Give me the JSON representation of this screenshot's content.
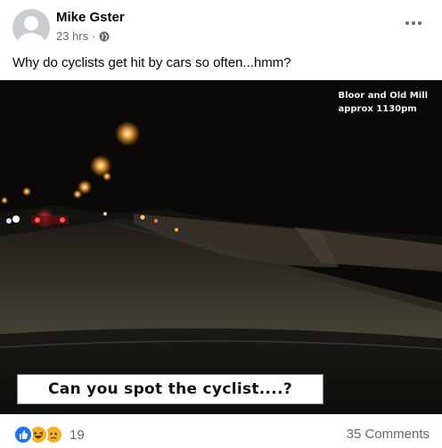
{
  "post": {
    "author": "Mike Gster",
    "time": "23 hrs",
    "dot": "·",
    "privacy_icon": "globe-icon",
    "more_icon": "more-dots-icon",
    "caption": "Why do cyclists get hit by cars so often...hmm?"
  },
  "media": {
    "overlay_top_line1": "Bloor and Old Mill",
    "overlay_top_line2": "approx 1130pm",
    "overlay_bottom": "Can you spot the cyclist....?"
  },
  "footer": {
    "reaction_icons": [
      "like-icon",
      "haha-icon",
      "sad-icon"
    ],
    "reaction_count": "19",
    "comments": "35 Comments"
  },
  "colors": {
    "like": "#1877f2",
    "haha": "#f7b125",
    "secondary_text": "#65676b"
  }
}
